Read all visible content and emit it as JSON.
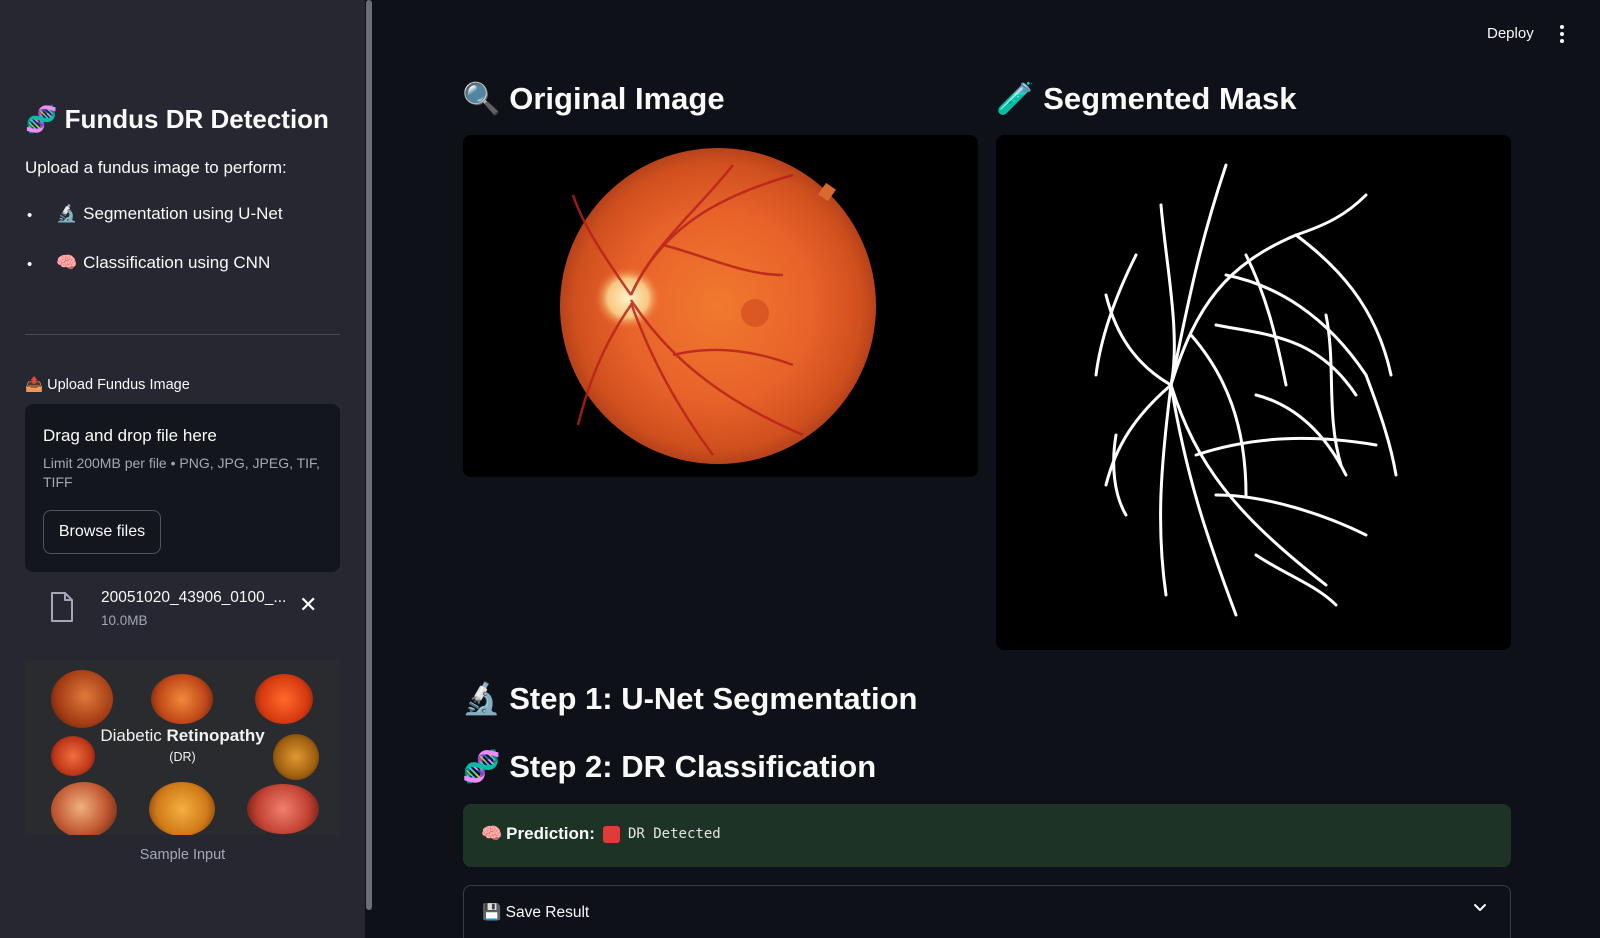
{
  "sidebar": {
    "title_emoji": "🧬",
    "title": "Fundus DR Detection",
    "description": "Upload a fundus image to perform:",
    "features": [
      {
        "emoji": "🔬",
        "label": "Segmentation using U-Net"
      },
      {
        "emoji": "🧠",
        "label": "Classification using CNN"
      }
    ],
    "upload": {
      "label_emoji": "📤",
      "label": "Upload Fundus Image",
      "dropzone_title": "Drag and drop file here",
      "limit": "Limit 200MB per file • PNG, JPG, JPEG, TIF, TIFF",
      "browse_label": "Browse files"
    },
    "file": {
      "name": "20051020_43906_0100_...",
      "size": "10.0MB"
    },
    "sample": {
      "title_light": "Diabetic ",
      "title_bold": "Retinopathy",
      "abbrev": "(DR)",
      "caption": "Sample Input"
    }
  },
  "header": {
    "deploy_label": "Deploy"
  },
  "main": {
    "original": {
      "emoji": "🔍",
      "title": "Original Image"
    },
    "mask": {
      "emoji": "🧪",
      "title": "Segmented Mask"
    },
    "step1": {
      "emoji": "🔬",
      "title": "Step 1: U-Net Segmentation"
    },
    "step2": {
      "emoji": "🧬",
      "title": "Step 2: DR Classification"
    },
    "prediction": {
      "emoji": "🧠",
      "label": "Prediction:",
      "value": "DR Detected",
      "status_color": "#e03a3a"
    },
    "save": {
      "emoji": "💾",
      "label": "Save Result"
    }
  },
  "colors": {
    "background": "#0e1117",
    "sidebar": "#262730",
    "success_bg": "#1d3326"
  }
}
